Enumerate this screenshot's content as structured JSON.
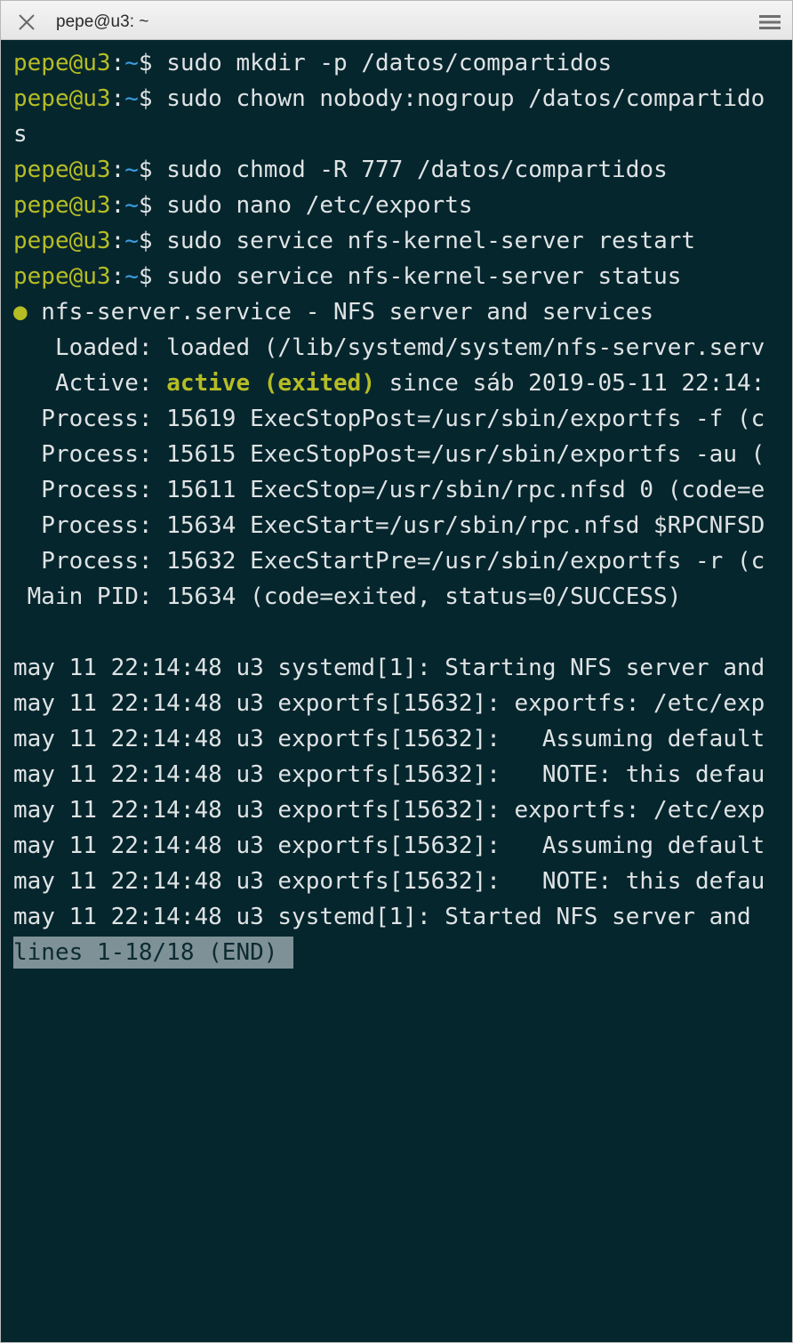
{
  "window": {
    "title": "pepe@u3: ~",
    "close_icon": "close-icon",
    "menu_icon": "hamburger-menu-icon",
    "colors": {
      "background": "#06262e",
      "prompt_user": "#b6bd24",
      "prompt_path": "#3a9ee3",
      "text": "#dfe3e4",
      "pager_bg": "#7d9196"
    }
  },
  "prompt": {
    "user": "pepe@u3",
    "colon": ":",
    "path": "~",
    "symbol": "$ "
  },
  "commands": [
    "sudo mkdir -p /datos/compartidos",
    "sudo chown nobody:nogroup /datos/compartido",
    "sudo chmod -R 777 /datos/compartidos",
    "sudo nano /etc/exports",
    "sudo service nfs-kernel-server restart",
    "sudo service nfs-kernel-server status"
  ],
  "wrap_continuation": "s",
  "status": {
    "dot": "●",
    "service_line": " nfs-server.service - NFS server and services",
    "loaded": "   Loaded: loaded (/lib/systemd/system/nfs-server.serv",
    "active_label": "   Active: ",
    "active_state": "active (exited)",
    "active_rest": " since sáb 2019-05-11 22:14:",
    "processes": [
      "  Process: 15619 ExecStopPost=/usr/sbin/exportfs -f (c",
      "  Process: 15615 ExecStopPost=/usr/sbin/exportfs -au (",
      "  Process: 15611 ExecStop=/usr/sbin/rpc.nfsd 0 (code=e",
      "  Process: 15634 ExecStart=/usr/sbin/rpc.nfsd $RPCNFSD",
      "  Process: 15632 ExecStartPre=/usr/sbin/exportfs -r (c"
    ],
    "main_pid": " Main PID: 15634 (code=exited, status=0/SUCCESS)"
  },
  "logs": [
    "may 11 22:14:48 u3 systemd[1]: Starting NFS server and",
    "may 11 22:14:48 u3 exportfs[15632]: exportfs: /etc/exp",
    "may 11 22:14:48 u3 exportfs[15632]:   Assuming default",
    "may 11 22:14:48 u3 exportfs[15632]:   NOTE: this defau",
    "may 11 22:14:48 u3 exportfs[15632]: exportfs: /etc/exp",
    "may 11 22:14:48 u3 exportfs[15632]:   Assuming default",
    "may 11 22:14:48 u3 exportfs[15632]:   NOTE: this defau",
    "may 11 22:14:48 u3 systemd[1]: Started NFS server and"
  ],
  "pager": {
    "status": "lines 1-18/18 (END)"
  }
}
